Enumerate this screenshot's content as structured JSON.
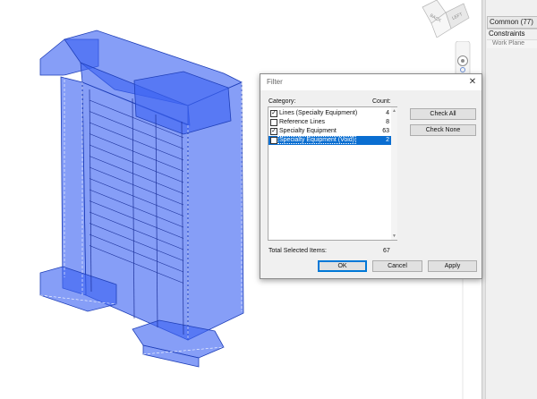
{
  "viewcube": {
    "faces": [
      "BACK",
      "LEFT"
    ]
  },
  "properties": {
    "type_row": "Common (77)",
    "group": "Constraints",
    "param": "Work Plane"
  },
  "dialog": {
    "title": "Filter",
    "close_glyph": "✕",
    "category_label": "Category:",
    "count_label": "Count:",
    "categories": [
      {
        "name": "Lines (Specialty Equipment)",
        "count": "4",
        "checked": true,
        "selected": false
      },
      {
        "name": "Reference Lines",
        "count": "8",
        "checked": false,
        "selected": false
      },
      {
        "name": "Specialty Equipment",
        "count": "63",
        "checked": true,
        "selected": false
      },
      {
        "name": "Specialty Equipment (Void)",
        "count": "2",
        "checked": false,
        "selected": true
      }
    ],
    "check_glyph": "✓",
    "scroll_up": "▲",
    "scroll_down": "▼",
    "check_all_label": "Check All",
    "check_none_label": "Check None",
    "total_label": "Total Selected Items:",
    "total_value": "67",
    "ok_label": "OK",
    "cancel_label": "Cancel",
    "apply_label": "Apply"
  },
  "colors": {
    "selection_blue": "#0a6ed1",
    "model_fill": "#3c63f2",
    "model_edge": "#1f3fb8"
  }
}
